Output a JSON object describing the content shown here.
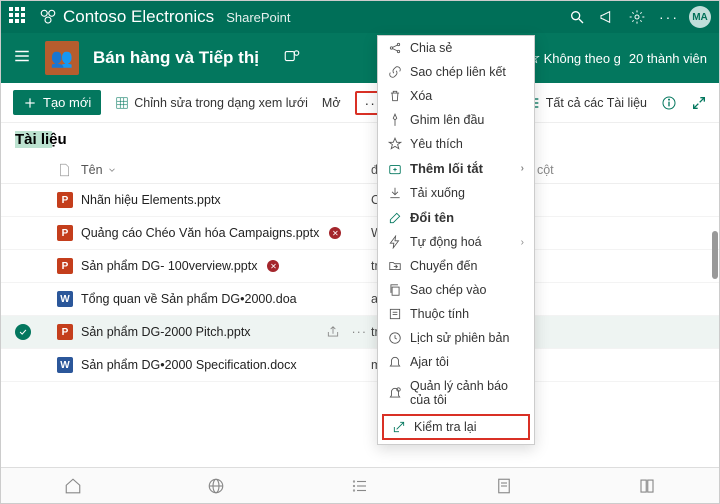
{
  "suite": {
    "brand": "Contoso Electronics",
    "product": "SharePoint",
    "avatar": "MA"
  },
  "site": {
    "name": "Bán hàng và Tiếp thị",
    "follow": "Không theo g",
    "members": "20 thành viên"
  },
  "commands": {
    "new": "Tạo mới",
    "edit_grid": "Chỉnh sửa trong dạng xem lưới",
    "open": "Mở",
    "all_docs": "Tất cả các Tài liệu"
  },
  "library": {
    "title": "Tài liệu"
  },
  "columns": {
    "name": "Tên",
    "modifiedBy": "đã nâng Bởi",
    "add": "Thêm cột"
  },
  "rows": [
    {
      "icon": "ppt",
      "name": "Nhãn hiệu Elements.pptx",
      "modBy": "O Administrator",
      "blocked": false,
      "selected": false
    },
    {
      "icon": "ppt",
      "name": "Quảng cáo Chéo Văn hóa Campaigns.pptx",
      "modBy": "Wilber",
      "blocked": true,
      "selected": false
    },
    {
      "icon": "ppt",
      "name": "Sản phẩm DG- 100verview.pptx",
      "modBy": "trên Bowen",
      "blocked": true,
      "selected": false
    },
    {
      "icon": "doc",
      "name": "Tổng quan về Sản phẩm DG•2000.doa",
      "modBy": "an Bowen",
      "blocked": false,
      "selected": false
    },
    {
      "icon": "ppt",
      "name": "Sản phẩm DG-2000 Pitch.pptx",
      "modBy": "trên Bowen",
      "blocked": false,
      "selected": true
    },
    {
      "icon": "doc",
      "name": "Sản phẩm DG•2000 Specification.docx",
      "modBy": "một Bob",
      "blocked": false,
      "selected": false
    }
  ],
  "menu": {
    "share": "Chia sẻ",
    "copy_link": "Sao chép liên kết",
    "delete": "Xóa",
    "pin_top": "Ghim lên đầu",
    "favorite": "Yêu thích",
    "add_shortcut": "Thêm lối tắt",
    "download": "Tải xuống",
    "rename": "Đổi tên",
    "automate": "Tự động hoá",
    "move_to": "Chuyển đến",
    "copy_to": "Sao chép vào",
    "properties": "Thuộc tính",
    "version_history": "Lịch sử phiên bản",
    "alert_me": "Ajar tôi",
    "manage_alerts": "Quản lý cảnh báo của tôi",
    "check_in": "Kiểm tra lại"
  }
}
